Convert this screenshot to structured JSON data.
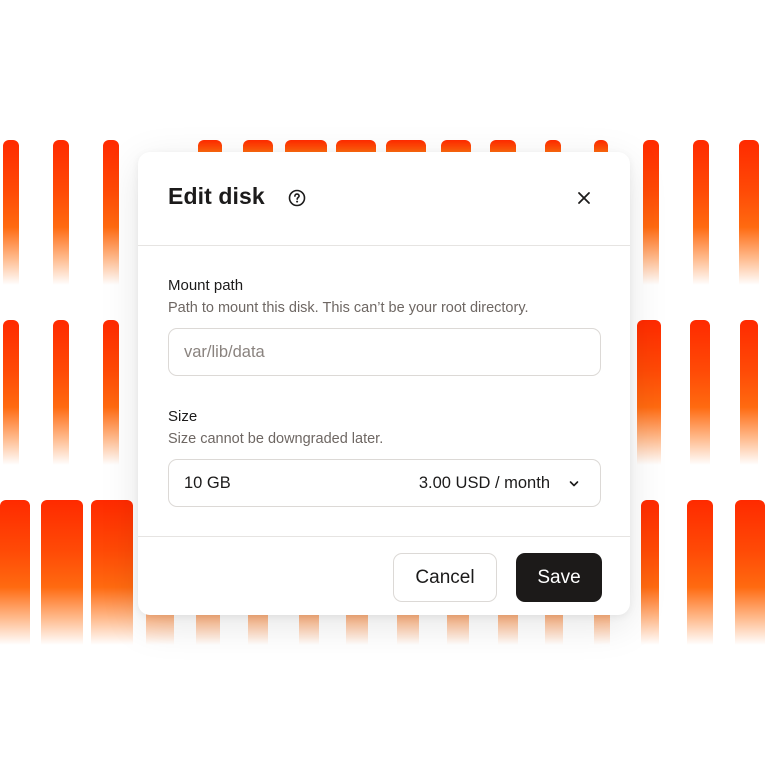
{
  "dialog": {
    "title": "Edit disk",
    "help_icon": "help-circle-icon",
    "close_icon": "close-icon"
  },
  "mount_path": {
    "label": "Mount path",
    "help": "Path to mount this disk. This can’t be your root directory.",
    "placeholder": "var/lib/data",
    "value": ""
  },
  "size": {
    "label": "Size",
    "help": "Size cannot be downgraded later.",
    "selected_value": "10 GB",
    "selected_price": "3.00 USD / month",
    "dropdown_icon": "chevron-down-icon"
  },
  "actions": {
    "cancel_label": "Cancel",
    "save_label": "Save"
  },
  "colors": {
    "accent_gradient_top": "#ff2a00",
    "accent_gradient_bottom": "#ff7a1e",
    "primary_button": "#1c1a19",
    "text": "#1c1b1b",
    "muted_text": "#6e6763"
  }
}
